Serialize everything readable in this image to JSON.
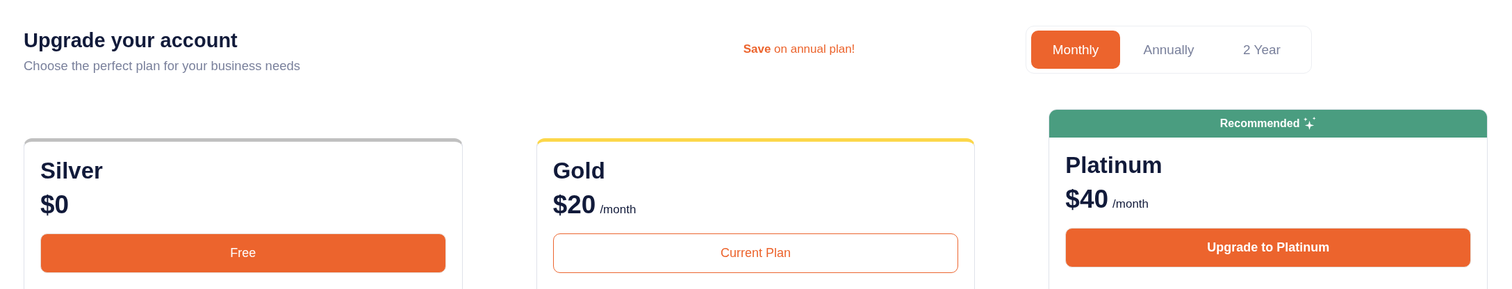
{
  "header": {
    "title": "Upgrade your account",
    "subtitle": "Choose the perfect plan for your business needs"
  },
  "promo": "**Save** on annual plan!",
  "billing_tabs": [
    {
      "label": "Monthly",
      "selected": true
    },
    {
      "label": "Annually",
      "selected": false
    },
    {
      "label": "2 Year",
      "selected": false
    }
  ],
  "plans": [
    {
      "name": "Silver",
      "price": "$0",
      "color": "#c0c0c0",
      "button": {
        "label": "Free",
        "kind": "primary"
      }
    },
    {
      "name": "Gold",
      "price": "$20",
      "period": "/month",
      "color": "#fcd74a",
      "button": {
        "label": "Current Plan",
        "kind": "outline"
      }
    },
    {
      "name": "Platinum",
      "price": "$40",
      "period": "/month",
      "color": "#4a9d80",
      "badge": "Recommended",
      "button": {
        "label": "Upgrade to Platinum",
        "kind": "primary"
      }
    }
  ]
}
